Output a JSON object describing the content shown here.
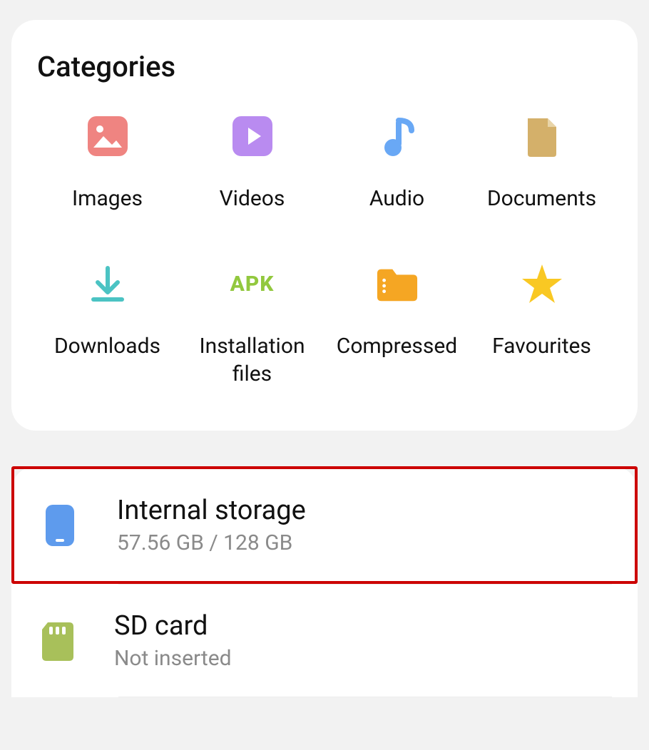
{
  "sections": {
    "categories_title": "Categories"
  },
  "categories": {
    "images": {
      "label": "Images"
    },
    "videos": {
      "label": "Videos"
    },
    "audio": {
      "label": "Audio"
    },
    "documents": {
      "label": "Documents"
    },
    "downloads": {
      "label": "Downloads"
    },
    "installation_files": {
      "label": "Installation files",
      "apk_text": "APK"
    },
    "compressed": {
      "label": "Compressed"
    },
    "favourites": {
      "label": "Favourites"
    }
  },
  "storage": {
    "internal": {
      "title": "Internal storage",
      "subtitle": "57.56 GB / 128 GB"
    },
    "sdcard": {
      "title": "SD card",
      "subtitle": "Not inserted"
    }
  }
}
